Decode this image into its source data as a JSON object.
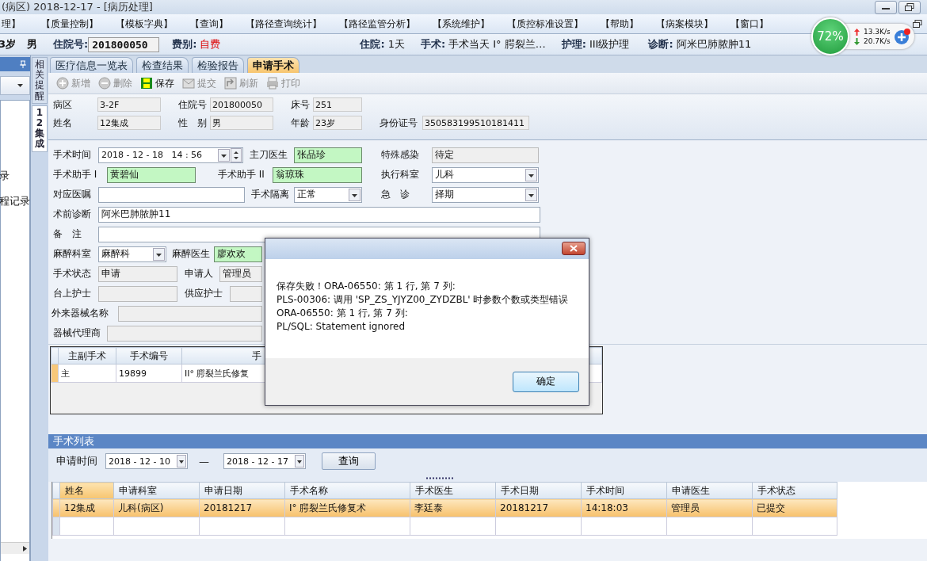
{
  "window": {
    "title": "(病区)  2018-12-17 - [病历处理]"
  },
  "menu": [
    "理】",
    "【质量控制】",
    "【模板字典】",
    "【查询】",
    "【路径查询统计】",
    "【路径监管分析】",
    "【系统维护】",
    "【质控标准设置】",
    "【帮助】",
    "【病案模块】",
    "【窗口】"
  ],
  "net_widget": {
    "percent": "72%",
    "up": "13.3K/s",
    "down": "20.7K/s"
  },
  "patient_bar": {
    "age": "3岁",
    "sex": "男",
    "fields": [
      {
        "label": "住院号:",
        "value": "201800050",
        "kind": "input"
      },
      {
        "label": "费别:",
        "value": "自费",
        "kind": "alert"
      },
      {
        "label": "住院:",
        "value": "1天",
        "kind": "text"
      },
      {
        "label": "手术:",
        "value": "手术当天 I° 腭裂兰…",
        "kind": "text"
      },
      {
        "label": "护理:",
        "value": "III级护理",
        "kind": "text"
      },
      {
        "label": "诊断:",
        "value": "阿米巴肺脓肿11",
        "kind": "text"
      }
    ]
  },
  "left_panel": {
    "items": [
      "录",
      "程记录"
    ]
  },
  "side_tabs": [
    {
      "label": "相关提醒",
      "selected": false
    },
    {
      "label": "12集成",
      "selected": true
    }
  ],
  "tabs": [
    {
      "label": "医疗信息一览表",
      "selected": false
    },
    {
      "label": "检查结果",
      "selected": false
    },
    {
      "label": "检验报告",
      "selected": false
    },
    {
      "label": "申请手术",
      "selected": true
    }
  ],
  "toolbar": [
    {
      "label": "新增",
      "kind": "add",
      "disabled": true
    },
    {
      "label": "删除",
      "kind": "remove",
      "disabled": true
    },
    {
      "label": "保存",
      "kind": "save",
      "disabled": false
    },
    {
      "label": "提交",
      "kind": "submit",
      "disabled": true
    },
    {
      "label": "刷新",
      "kind": "refresh",
      "disabled": true
    },
    {
      "label": "打印",
      "kind": "print",
      "disabled": true
    }
  ],
  "summary": {
    "rows": [
      {
        "cells": [
          {
            "label": "病区",
            "value": "3-2F"
          },
          {
            "label": "住院号",
            "value": "201800050"
          },
          {
            "label": "床号",
            "value": "251"
          }
        ]
      },
      {
        "cells": [
          {
            "label": "姓名",
            "value": "12集成"
          },
          {
            "label": "性　别",
            "value": "男"
          },
          {
            "label": "年龄",
            "value": "23岁"
          },
          {
            "label": "身份证号",
            "value": "350583199510181411"
          }
        ]
      }
    ]
  },
  "surgery_form": {
    "rows": [
      {
        "cells": [
          {
            "label": "手术时间",
            "kind": "datetime",
            "value": "2018 - 12 - 18   14 : 56"
          },
          {
            "label": "主刀医生",
            "kind": "staff",
            "value": "张品珍"
          },
          {
            "label": "特殊感染",
            "kind": "readonly",
            "value": "待定"
          }
        ]
      },
      {
        "cells": [
          {
            "label": "手术助手 I",
            "kind": "staff",
            "value": "黄碧仙"
          },
          {
            "label": "手术助手 II",
            "kind": "staff",
            "value": "翁琼珠"
          },
          {
            "label": "执行科室",
            "kind": "select",
            "value": "儿科"
          }
        ]
      },
      {
        "cells": [
          {
            "label": "对应医嘱",
            "kind": "text"
          },
          {
            "label": "手术隔离",
            "kind": "select",
            "value": "正常"
          },
          {
            "label": "急　诊",
            "kind": "select",
            "value": "择期"
          }
        ]
      },
      {
        "cells": [
          {
            "label": "术前诊断",
            "kind": "text",
            "value": "阿米巴肺脓肿11"
          }
        ]
      },
      {
        "cells": [
          {
            "label": "备　注",
            "kind": "text"
          }
        ]
      },
      {
        "cells": [
          {
            "label": "麻醉科室",
            "kind": "select",
            "value": "麻醉科"
          },
          {
            "label": "麻醉医生",
            "kind": "staff",
            "value": "廖欢欢"
          }
        ]
      },
      {
        "cells": [
          {
            "label": "手术状态",
            "kind": "readonly",
            "value": "申请"
          },
          {
            "label": "申请人",
            "kind": "readonly",
            "value": "管理员"
          }
        ]
      },
      {
        "cells": [
          {
            "label": "台上护士",
            "kind": "readonly"
          },
          {
            "label": "供应护士",
            "kind": "readonly"
          }
        ]
      },
      {
        "cells": [
          {
            "label": "外来器械名称",
            "kind": "readonly"
          }
        ]
      },
      {
        "cells": [
          {
            "label": "器械代理商",
            "kind": "readonly"
          }
        ]
      }
    ]
  },
  "operations_table": {
    "columns": [
      "主副手术",
      "手术编号",
      "手"
    ],
    "rows": [
      {
        "selected": true,
        "cells": [
          "主",
          "19899",
          "II° 腭裂兰氏修复"
        ]
      }
    ]
  },
  "surgery_list": {
    "title": "手术列表",
    "filter_label": "申请时间",
    "date_from": "2018 - 12 - 10",
    "separator": "—",
    "date_to": "2018 - 12 - 17",
    "query_button": "查询",
    "columns": [
      "姓名",
      "申请科室",
      "申请日期",
      "手术名称",
      "手术医生",
      "手术日期",
      "手术时间",
      "申请医生",
      "手术状态"
    ],
    "rows": [
      {
        "selected": true,
        "cells": [
          "12集成",
          "儿科(病区)",
          "20181217",
          "I° 腭裂兰氏修复术",
          "李廷泰",
          "20181217",
          "14:18:03",
          "管理员",
          "已提交"
        ]
      }
    ]
  },
  "dialog": {
    "message_lines": [
      "保存失败！ORA-06550: 第 1 行, 第 7 列:",
      "PLS-00306: 调用 'SP_ZS_YJYZ00_ZYDZBL' 时参数个数或类型错误",
      "ORA-06550: 第 1 行, 第 7 列:",
      "PL/SQL: Statement ignored"
    ],
    "ok_button": "确定"
  }
}
